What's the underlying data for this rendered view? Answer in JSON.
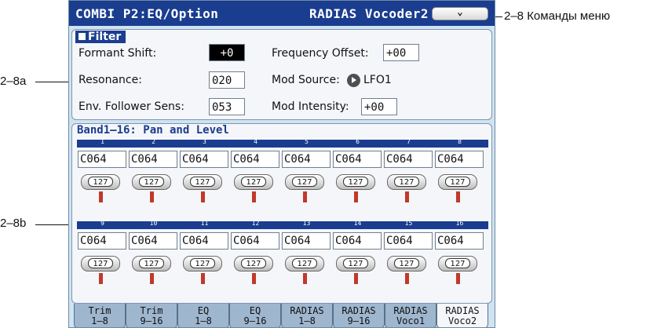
{
  "annotations": {
    "menu_commands": "2–8 Команды меню",
    "filter_section": "2–8a",
    "band_section": "2–8b"
  },
  "titlebar": {
    "page": "COMBI P2:EQ/Option",
    "program": "RADIAS Vocoder2"
  },
  "filter": {
    "title": "Filter",
    "formant_shift": {
      "label": "Formant Shift:",
      "value": "+0"
    },
    "resonance": {
      "label": "Resonance:",
      "value": "020"
    },
    "env_follower": {
      "label": "Env. Follower Sens:",
      "value": "053"
    },
    "frequency_offset": {
      "label": "Frequency Offset:",
      "value": "+00"
    },
    "mod_source": {
      "label": "Mod Source:",
      "value": "LFO1"
    },
    "mod_intensity": {
      "label": "Mod Intensity:",
      "value": "+00"
    }
  },
  "bands": {
    "title": "Band1–16: Pan and Level",
    "row1": [
      {
        "num": "1",
        "pan": "C064",
        "level": "127"
      },
      {
        "num": "2",
        "pan": "C064",
        "level": "127"
      },
      {
        "num": "3",
        "pan": "C064",
        "level": "127"
      },
      {
        "num": "4",
        "pan": "C064",
        "level": "127"
      },
      {
        "num": "5",
        "pan": "C064",
        "level": "127"
      },
      {
        "num": "6",
        "pan": "C064",
        "level": "127"
      },
      {
        "num": "7",
        "pan": "C064",
        "level": "127"
      },
      {
        "num": "8",
        "pan": "C064",
        "level": "127"
      }
    ],
    "row2": [
      {
        "num": "9",
        "pan": "C064",
        "level": "127"
      },
      {
        "num": "10",
        "pan": "C064",
        "level": "127"
      },
      {
        "num": "11",
        "pan": "C064",
        "level": "127"
      },
      {
        "num": "12",
        "pan": "C064",
        "level": "127"
      },
      {
        "num": "13",
        "pan": "C064",
        "level": "127"
      },
      {
        "num": "14",
        "pan": "C064",
        "level": "127"
      },
      {
        "num": "15",
        "pan": "C064",
        "level": "127"
      },
      {
        "num": "16",
        "pan": "C064",
        "level": "127"
      }
    ]
  },
  "tabs": [
    {
      "line1": "Trim",
      "line2": "1–8"
    },
    {
      "line1": "Trim",
      "line2": "9–16"
    },
    {
      "line1": "EQ",
      "line2": "1–8"
    },
    {
      "line1": "EQ",
      "line2": "9–16"
    },
    {
      "line1": "RADIAS",
      "line2": "1–8"
    },
    {
      "line1": "RADIAS",
      "line2": "9–16"
    },
    {
      "line1": "RADIAS",
      "line2": "Voco1"
    },
    {
      "line1": "RADIAS",
      "line2": "Voco2"
    }
  ],
  "active_tab_index": 7,
  "colors": {
    "titlebar": "#1a3d8f",
    "screen_bg": "#cfe3f1",
    "level_bar": "#c0392b"
  },
  "icons": {
    "menu_button": "chevron-down-icon",
    "mod_source": "play-arrow-icon"
  }
}
